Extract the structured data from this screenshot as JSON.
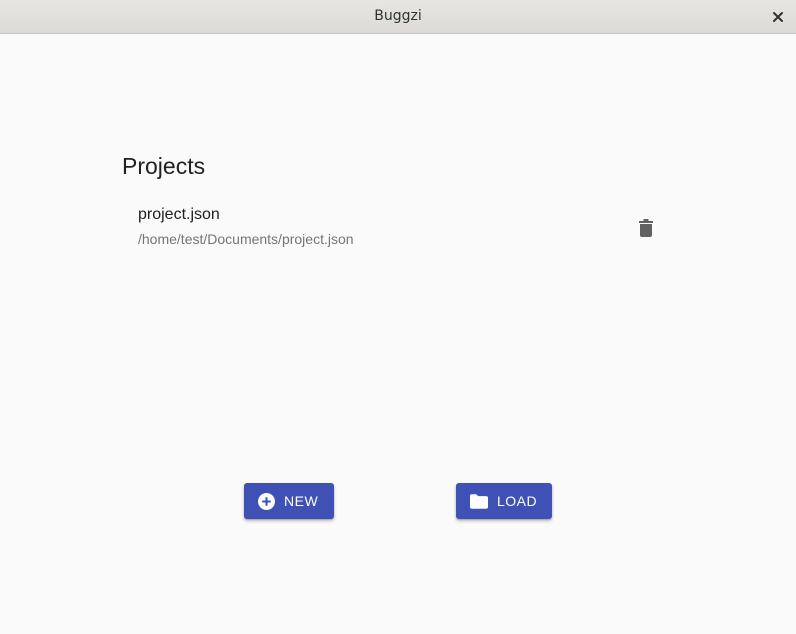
{
  "window": {
    "title": "Buggzi",
    "close_icon": "close-icon"
  },
  "projects": {
    "heading": "Projects",
    "items": [
      {
        "name": "project.json",
        "path": "/home/test/Documents/project.json",
        "delete_icon": "trash-icon"
      }
    ]
  },
  "actions": {
    "new_label": "NEW",
    "new_icon": "add-circle-icon",
    "load_label": "LOAD",
    "load_icon": "folder-icon"
  },
  "colors": {
    "primary": "#3f51b5",
    "background": "#fafafa",
    "titlebar": "#e0dedb"
  }
}
